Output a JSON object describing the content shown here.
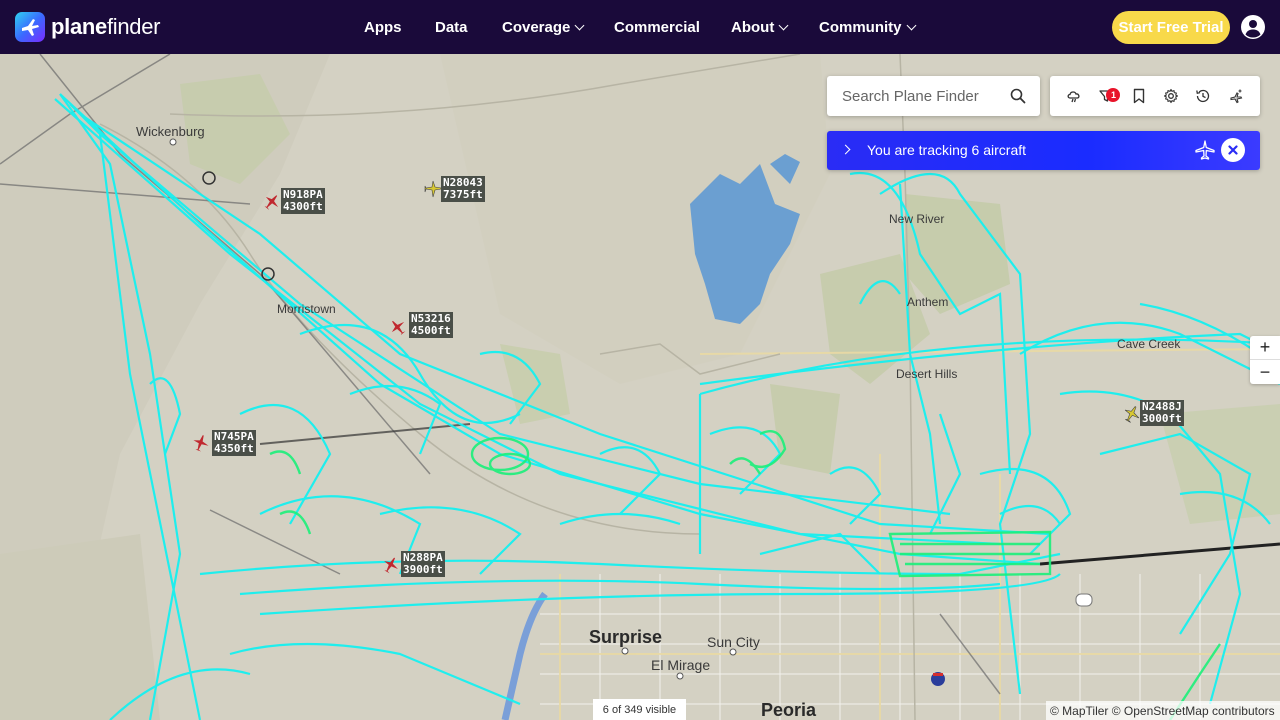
{
  "brand": {
    "bold": "plane",
    "light": "finder"
  },
  "nav": {
    "items": [
      {
        "label": "Apps",
        "dropdown": false
      },
      {
        "label": "Data",
        "dropdown": false
      },
      {
        "label": "Coverage",
        "dropdown": true
      },
      {
        "label": "Commercial",
        "dropdown": false
      },
      {
        "label": "About",
        "dropdown": true
      },
      {
        "label": "Community",
        "dropdown": true
      }
    ],
    "trial_label": "Start Free Trial"
  },
  "search": {
    "placeholder": "Search Plane Finder"
  },
  "toolbar": {
    "filter_badge": "1"
  },
  "tracking": {
    "text": "You are tracking 6 aircraft"
  },
  "zoom": {
    "in": "+",
    "out": "−"
  },
  "visible_count": "6 of 349 visible",
  "attribution": "© MapTiler © OpenStreetMap contributors",
  "places": [
    {
      "name": "Wickenburg",
      "size": "normal"
    },
    {
      "name": "New River",
      "size": "normal"
    },
    {
      "name": "Anthem",
      "size": "normal"
    },
    {
      "name": "Cave Creek",
      "size": "normal"
    },
    {
      "name": "Desert Hills",
      "size": "normal"
    },
    {
      "name": "Surprise",
      "size": "big"
    },
    {
      "name": "Sun City",
      "size": "mid"
    },
    {
      "name": "El Mirage",
      "size": "mid"
    },
    {
      "name": "Peoria",
      "size": "big"
    },
    {
      "name": "Morristown",
      "size": "normal"
    }
  ],
  "aircraft": [
    {
      "callsign": "N918PA",
      "altitude": "4300ft",
      "color": "#c0282f"
    },
    {
      "callsign": "N28043",
      "altitude": "7375ft",
      "color": "#d8c832"
    },
    {
      "callsign": "N53216",
      "altitude": "4500ft",
      "color": "#c0282f"
    },
    {
      "callsign": "N745PA",
      "altitude": "4350ft",
      "color": "#c0282f"
    },
    {
      "callsign": "N288PA",
      "altitude": "3900ft",
      "color": "#c0282f"
    },
    {
      "callsign": "N2488J",
      "altitude": "3000ft",
      "color": "#d8c832"
    }
  ],
  "colors": {
    "nav_bg": "#1a0a3a",
    "trial_bg": "#f8d94a",
    "track": "#16f0f0",
    "track_low": "#1cf07a",
    "tracking_bar": "#2a2cf5",
    "lake": "#6b9fd1"
  }
}
